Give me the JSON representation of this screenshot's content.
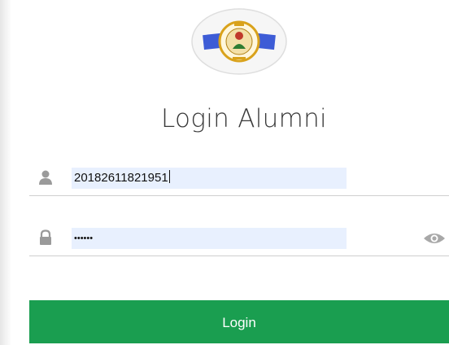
{
  "form": {
    "title": "Login Alumni",
    "username": {
      "value": "20182611821951",
      "icon": "user-icon"
    },
    "password": {
      "value": "••••••",
      "icon": "lock-icon",
      "toggle_icon": "eye-icon"
    },
    "submit_label": "Login"
  },
  "colors": {
    "accent": "#1a9e50",
    "autofill_bg": "#e8f0fe",
    "logo_blue": "#3d5cd6",
    "logo_gold": "#d9a21b"
  }
}
